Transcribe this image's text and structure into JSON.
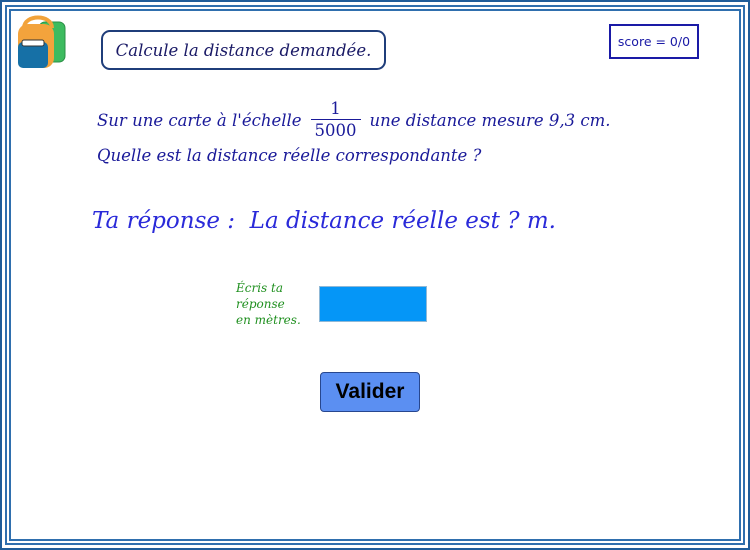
{
  "app": {
    "icon": "backpack-icon",
    "accent_color": "#1f5c99"
  },
  "header": {
    "instruction": "Calcule la distance demandée.",
    "score_label": "score = 0/0"
  },
  "problem": {
    "line1_before": "Sur une carte à l'échelle",
    "scale_numerator": "1",
    "scale_denominator": "5000",
    "line1_after": "une distance mesure 9,3 cm.",
    "line2": "Quelle est la distance réelle correspondante ?"
  },
  "answer": {
    "sentence": "Ta réponse :  La distance réelle est ? m."
  },
  "input": {
    "hint_line1": "Écris ta",
    "hint_line2": "réponse",
    "hint_line3": "en mètres.",
    "value": "",
    "field_color": "#0596f7"
  },
  "actions": {
    "validate_label": "Valider",
    "validate_color": "#5b8ff2"
  }
}
